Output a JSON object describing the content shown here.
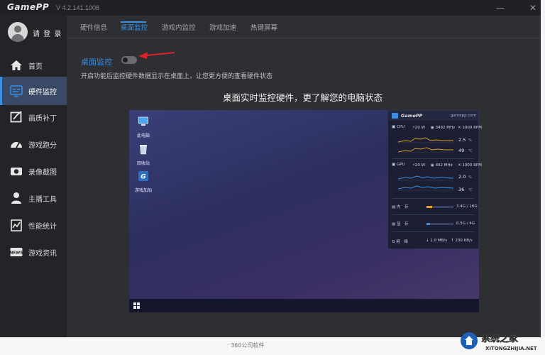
{
  "app": {
    "logo": "GamePP",
    "version": "V 4.2.141.1008"
  },
  "window_controls": {
    "minimize": "—",
    "close": "✕"
  },
  "sidebar": {
    "login_label": "请 登 录",
    "items": [
      {
        "label": "首页",
        "icon": "home-icon"
      },
      {
        "label": "硬件监控",
        "icon": "hardware-monitor-icon",
        "active": true
      },
      {
        "label": "画质补丁",
        "icon": "image-patch-icon"
      },
      {
        "label": "游戏跑分",
        "icon": "speedometer-icon"
      },
      {
        "label": "录像截图",
        "icon": "camera-icon"
      },
      {
        "label": "主播工具",
        "icon": "streamer-icon"
      },
      {
        "label": "性能统计",
        "icon": "stats-icon"
      },
      {
        "label": "游戏资讯",
        "icon": "news-icon"
      }
    ]
  },
  "tabs": [
    {
      "label": "硬件信息"
    },
    {
      "label": "桌面监控",
      "active": true
    },
    {
      "label": "游戏内监控"
    },
    {
      "label": "游戏加速"
    },
    {
      "label": "热键屏幕"
    }
  ],
  "content": {
    "section_title": "桌面监控",
    "toggle_on": false,
    "description": "开启功能后监控硬件数据显示在桌面上，让您更方便的查看硬件状态",
    "headline": "桌面实时监控硬件，更了解您的电脑状态"
  },
  "preview": {
    "desktop_icons": [
      {
        "label": "此电脑",
        "icon": "computer-icon"
      },
      {
        "label": "回收站",
        "icon": "recycle-bin-icon"
      },
      {
        "label": "游戏加加",
        "icon": "gamepp-icon"
      }
    ],
    "overlay": {
      "logo": "GamePP",
      "site": "gamepp.com",
      "cpu": {
        "label": "CPU",
        "power": "20 W",
        "clock": "3492 MHz",
        "fan": "1000 RPM",
        "usage": "2.5",
        "usage_unit": "%",
        "temp": "49",
        "temp_unit": "℃"
      },
      "gpu": {
        "label": "GPU",
        "power": "20 W",
        "clock": "492 MHz",
        "fan": "1000 RPM",
        "usage": "2.0",
        "usage_unit": "%",
        "temp": "36",
        "temp_unit": "℃"
      },
      "memory": {
        "label": "内　存",
        "value": "3.4G / 16G",
        "fill": 0.21
      },
      "vram": {
        "label": "显　存",
        "value": "0.5G / 4G",
        "fill": 0.13
      },
      "network": {
        "label": "网　络",
        "down": "1.0 MB/s",
        "up": "230 KB/s"
      }
    }
  },
  "page_footer": {
    "partial_text": "· 360公司软件"
  },
  "watermark": {
    "title": "系统之家",
    "url": "XITONGZHIJIA.NET"
  },
  "colors": {
    "accent": "#3b8ee0",
    "arrow": "#e0202a",
    "memory_bar": "#f0a020",
    "vram_bar": "#3b8ee0"
  }
}
